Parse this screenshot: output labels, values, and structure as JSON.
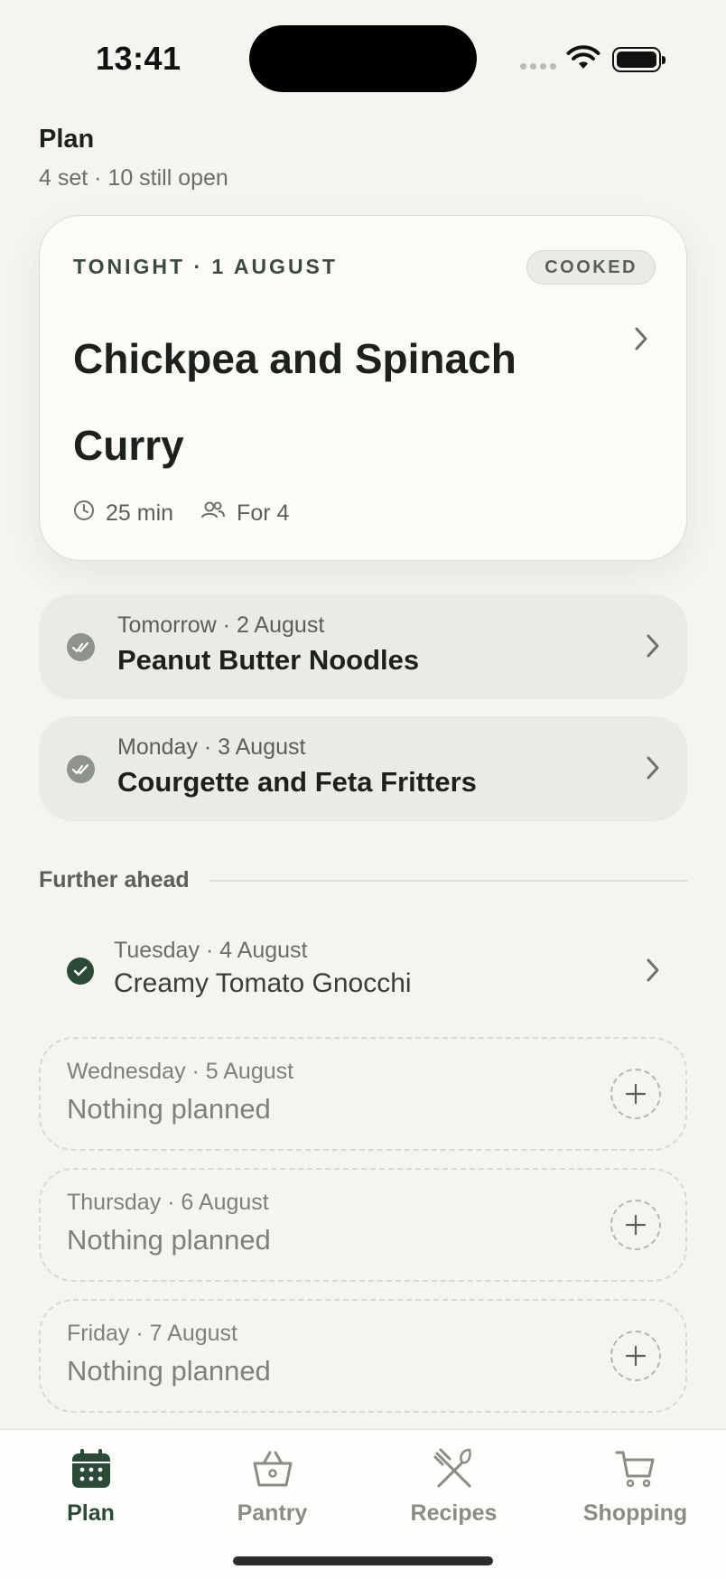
{
  "status": {
    "time": "13:41"
  },
  "header": {
    "title": "Plan",
    "subtitle": "4 set · 10 still open"
  },
  "hero": {
    "kicker": "TONIGHT · 1 AUGUST",
    "badge": "COOKED",
    "title": "Chickpea and Spinach Curry",
    "duration": "25 min",
    "servings": "For 4"
  },
  "upcoming": [
    {
      "date": "Tomorrow · 2 August",
      "name": "Peanut Butter Noodles"
    },
    {
      "date": "Monday · 3 August",
      "name": "Courgette and Feta Fritters"
    }
  ],
  "section": {
    "label": "Further ahead"
  },
  "planned": {
    "date": "Tuesday · 4 August",
    "name": "Creamy Tomato Gnocchi"
  },
  "empty_days": [
    {
      "date": "Wednesday · 5 August",
      "text": "Nothing planned"
    },
    {
      "date": "Thursday · 6 August",
      "text": "Nothing planned"
    },
    {
      "date": "Friday · 7 August",
      "text": "Nothing planned"
    }
  ],
  "tabs": [
    {
      "label": "Plan",
      "icon": "calendar-icon",
      "active": true
    },
    {
      "label": "Pantry",
      "icon": "basket-icon",
      "active": false
    },
    {
      "label": "Recipes",
      "icon": "utensils-icon",
      "active": false
    },
    {
      "label": "Shopping",
      "icon": "cart-icon",
      "active": false
    }
  ],
  "colors": {
    "background": "#f5f4ef",
    "accent": "#2c4a38",
    "card": "#fcfbf8",
    "muted_card": "#ebeae4"
  }
}
